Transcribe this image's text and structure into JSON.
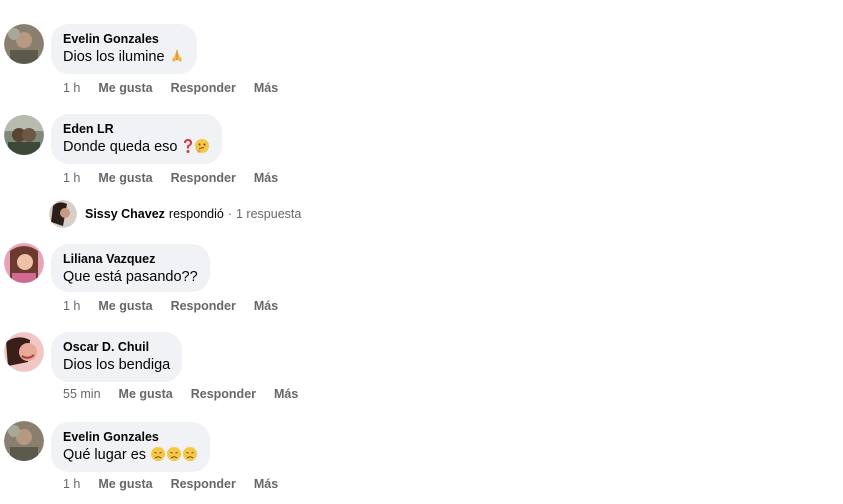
{
  "comments": [
    {
      "author": "Evelin Gonzales",
      "text": "Dios los ilumine",
      "emojis": [
        "folded-hands"
      ],
      "time": "1 h",
      "like": "Me gusta",
      "reply": "Responder",
      "more": "Más"
    },
    {
      "author": "Eden LR",
      "text": "Donde queda eso",
      "emojis": [
        "red-question-mark",
        "thinking-face"
      ],
      "time": "1 h",
      "like": "Me gusta",
      "reply": "Responder",
      "more": "Más",
      "replies": {
        "name": "Sissy Chavez",
        "verb": "respondió",
        "separator": "·",
        "count": "1 respuesta"
      }
    },
    {
      "author": "Liliana Vazquez",
      "text": "Que está pasando??",
      "emojis": [],
      "time": "1 h",
      "like": "Me gusta",
      "reply": "Responder",
      "more": "Más"
    },
    {
      "author": "Oscar D. Chuil",
      "text": "Dios los bendiga",
      "emojis": [],
      "time": "55 min",
      "like": "Me gusta",
      "reply": "Responder",
      "more": "Más"
    },
    {
      "author": "Evelin Gonzales",
      "text": "Qué lugar es",
      "emojis": [
        "disappointed-face",
        "disappointed-face",
        "disappointed-face"
      ],
      "time": "1 h",
      "like": "Me gusta",
      "reply": "Responder",
      "more": "Más"
    }
  ],
  "colors": {
    "bubble": "#f0f2f5",
    "meta": "#65676b",
    "text": "#050505"
  }
}
